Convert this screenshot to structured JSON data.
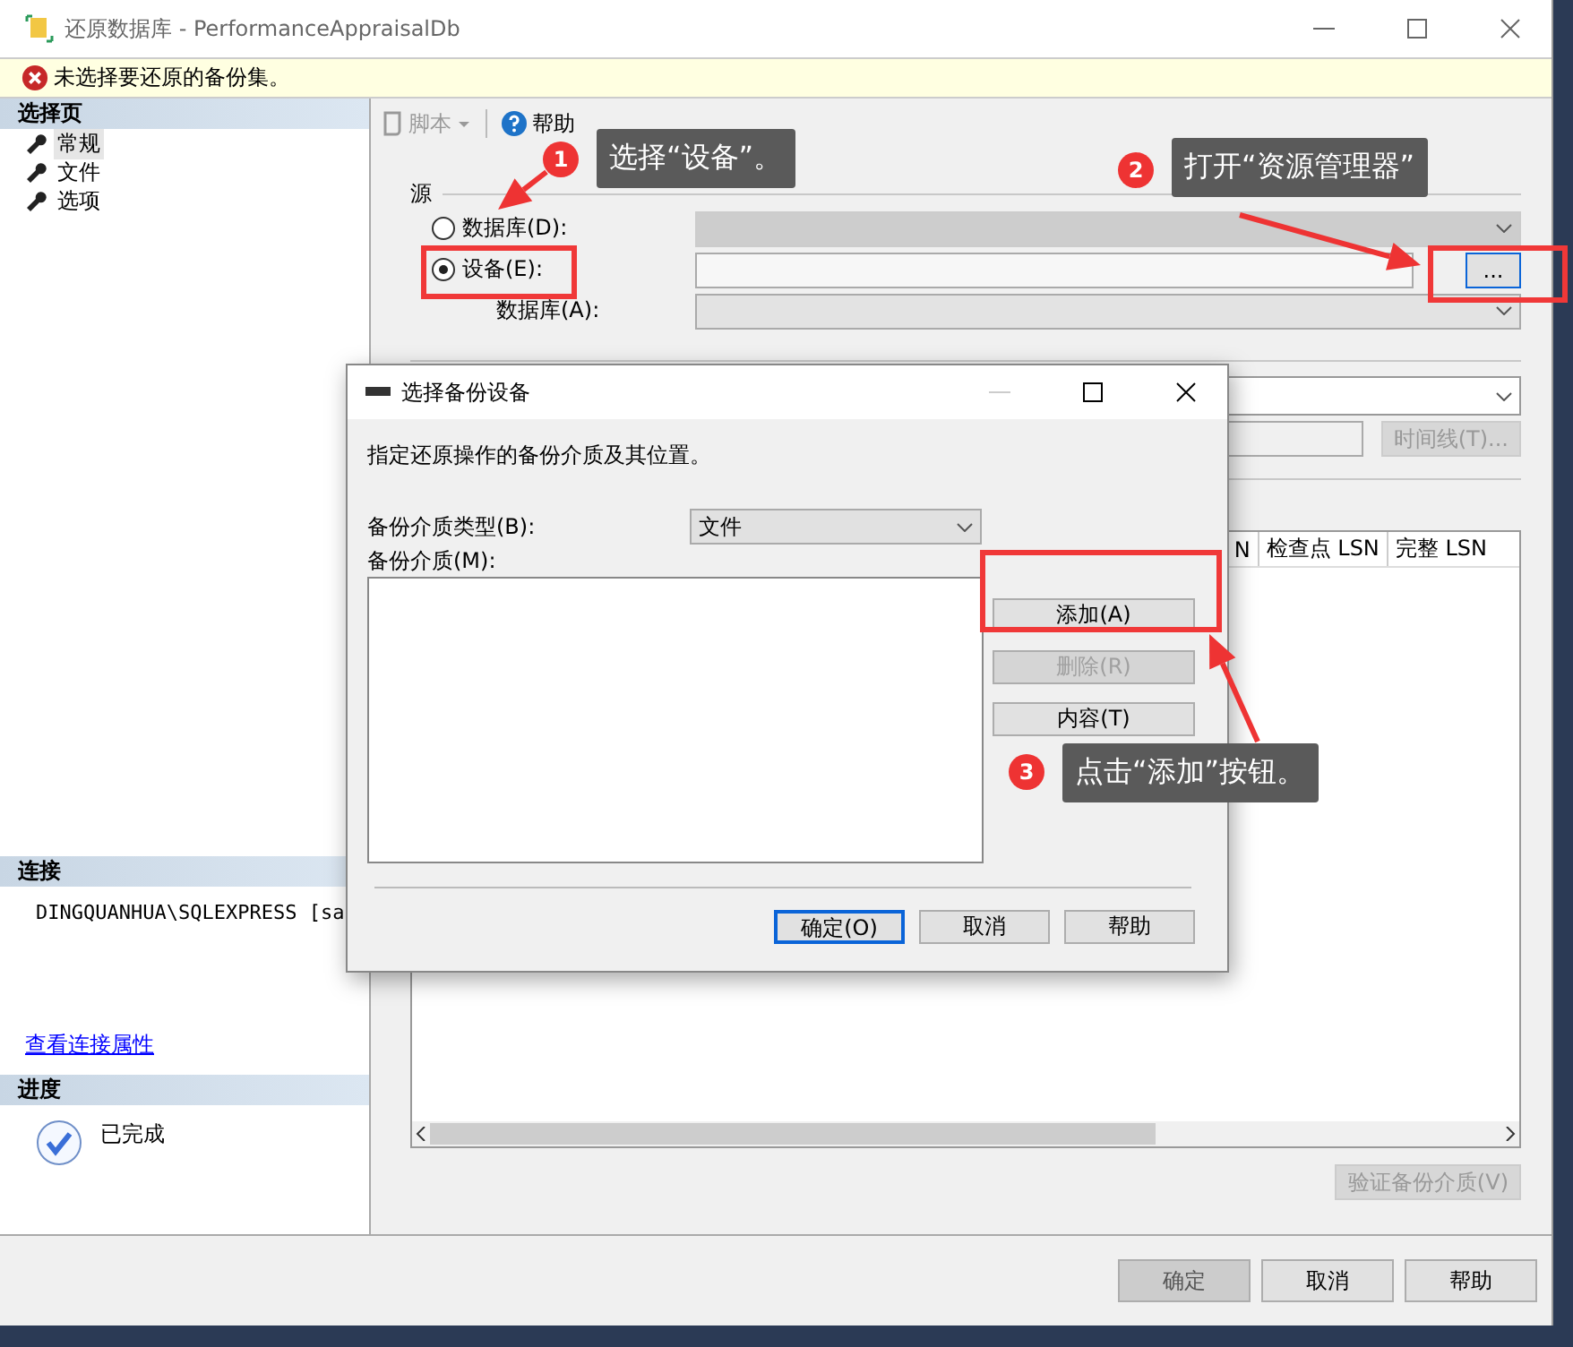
{
  "window": {
    "title": "还原数据库 - PerformanceAppraisalDb"
  },
  "message_bar": {
    "text": "未选择要还原的备份集。"
  },
  "sidebar": {
    "pages_header": "选择页",
    "pages": [
      {
        "label": "常规",
        "selected": true
      },
      {
        "label": "文件",
        "selected": false
      },
      {
        "label": "选项",
        "selected": false
      }
    ],
    "connection_header": "连接",
    "connection": "DINGQUANHUA\\SQLEXPRESS [sa",
    "connection_link": "查看连接属性",
    "progress_header": "进度",
    "progress_status": "已完成"
  },
  "toolbar": {
    "script_button": {
      "label": "脚本",
      "disabled": true
    },
    "help_button": {
      "label": "帮助"
    }
  },
  "source": {
    "title": "源",
    "options": [
      {
        "label": "数据库(D):",
        "selected": false
      },
      {
        "label": "设备(E):",
        "selected": true
      }
    ],
    "browse_button": "...",
    "database_label": "数据库(A):"
  },
  "destination": {
    "timeline_button": "时间线(T)..."
  },
  "backup_sets": {
    "columns": [
      "N",
      "检查点 LSN",
      "完整 LSN"
    ]
  },
  "verify_button": "验证备份介质(V)",
  "footer_buttons": [
    {
      "label": "确定",
      "disabled": true
    },
    {
      "label": "取消",
      "disabled": false
    },
    {
      "label": "帮助",
      "disabled": false
    }
  ],
  "dialog": {
    "title": "选择备份设备",
    "description": "指定还原操作的备份介质及其位置。",
    "media_type_label": "备份介质类型(B):",
    "media_type_value": "文件",
    "media_label": "备份介质(M):",
    "side_buttons": [
      {
        "label": "添加(A)",
        "disabled": false
      },
      {
        "label": "删除(R)",
        "disabled": true
      },
      {
        "label": "内容(T)",
        "disabled": false
      }
    ],
    "footer_buttons": [
      {
        "label": "确定(O)",
        "focused": true
      },
      {
        "label": "取消",
        "focused": false
      },
      {
        "label": "帮助",
        "focused": false
      }
    ]
  },
  "callouts": [
    {
      "number": "1",
      "text": "选择“设备”。"
    },
    {
      "number": "2",
      "text": "打开“资源管理器”"
    },
    {
      "number": "3",
      "text": "点击“添加”按钮。"
    }
  ]
}
